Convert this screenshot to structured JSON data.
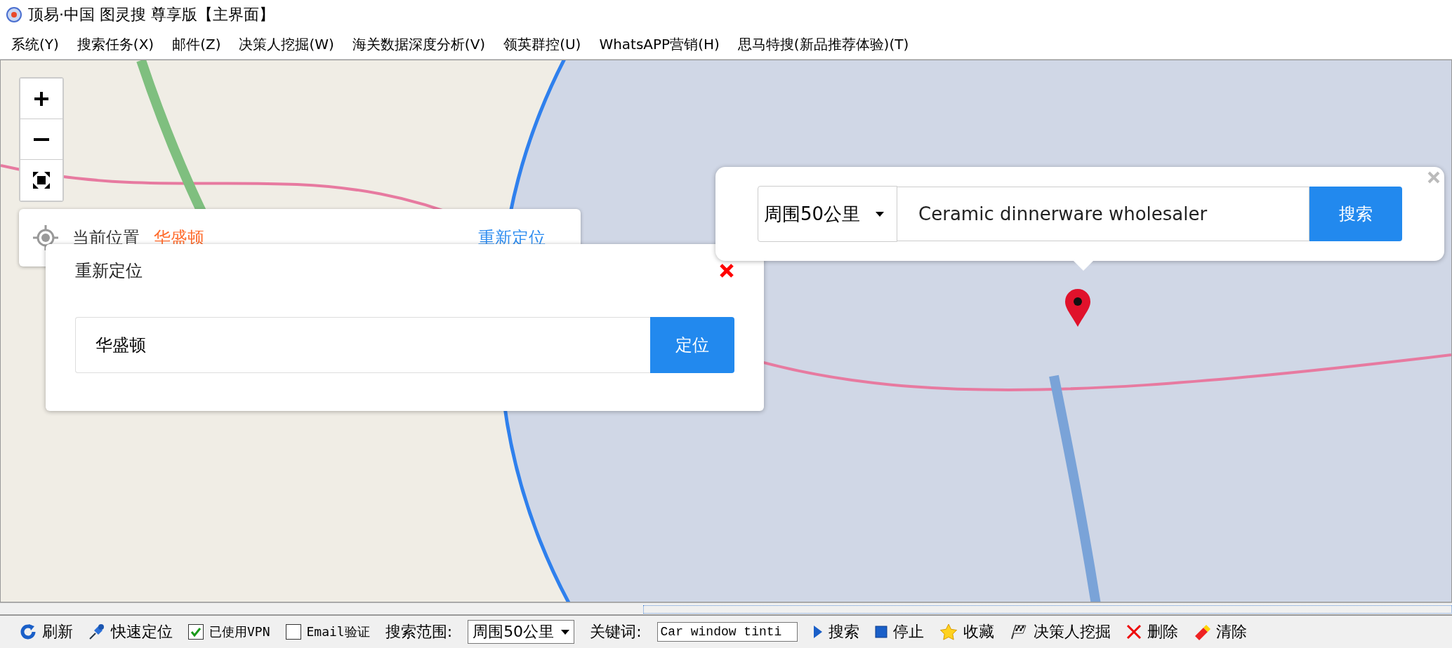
{
  "window": {
    "title": "顶易·中国 图灵搜 尊享版【主界面】"
  },
  "menu": [
    "系统(Y)",
    "搜索任务(X)",
    "邮件(Z)",
    "决策人挖掘(W)",
    "海关数据深度分析(V)",
    "领英群控(U)",
    "WhatsAPP营销(H)",
    "思马特搜(新品推荐体验)(T)"
  ],
  "location_card": {
    "label": "当前位置",
    "city": "华盛顿",
    "action": "重新定位"
  },
  "relocate_dialog": {
    "title": "重新定位",
    "value": "华盛顿",
    "button": "定位"
  },
  "search_popup": {
    "range": "周围50公里",
    "keyword": "Ceramic dinnerware wholesaler",
    "button": "搜索"
  },
  "toolbar": [
    {
      "kind": "button",
      "label": "刷新"
    },
    {
      "kind": "button",
      "label": "快速定位"
    },
    {
      "kind": "checkbox",
      "label": "已使用VPN",
      "checked": true
    },
    {
      "kind": "checkbox",
      "label": "Email验证",
      "checked": false
    },
    {
      "kind": "label",
      "label": "搜索范围:"
    },
    {
      "kind": "select",
      "value": "周围50公里"
    },
    {
      "kind": "label",
      "label": "关键词:"
    },
    {
      "kind": "input",
      "value": "Car window tinti"
    },
    {
      "kind": "button",
      "label": "搜索"
    },
    {
      "kind": "button",
      "label": "停止"
    },
    {
      "kind": "button",
      "label": "收藏"
    },
    {
      "kind": "button",
      "label": "决策人挖掘"
    },
    {
      "kind": "button",
      "label": "删除"
    },
    {
      "kind": "button",
      "label": "清除"
    }
  ]
}
